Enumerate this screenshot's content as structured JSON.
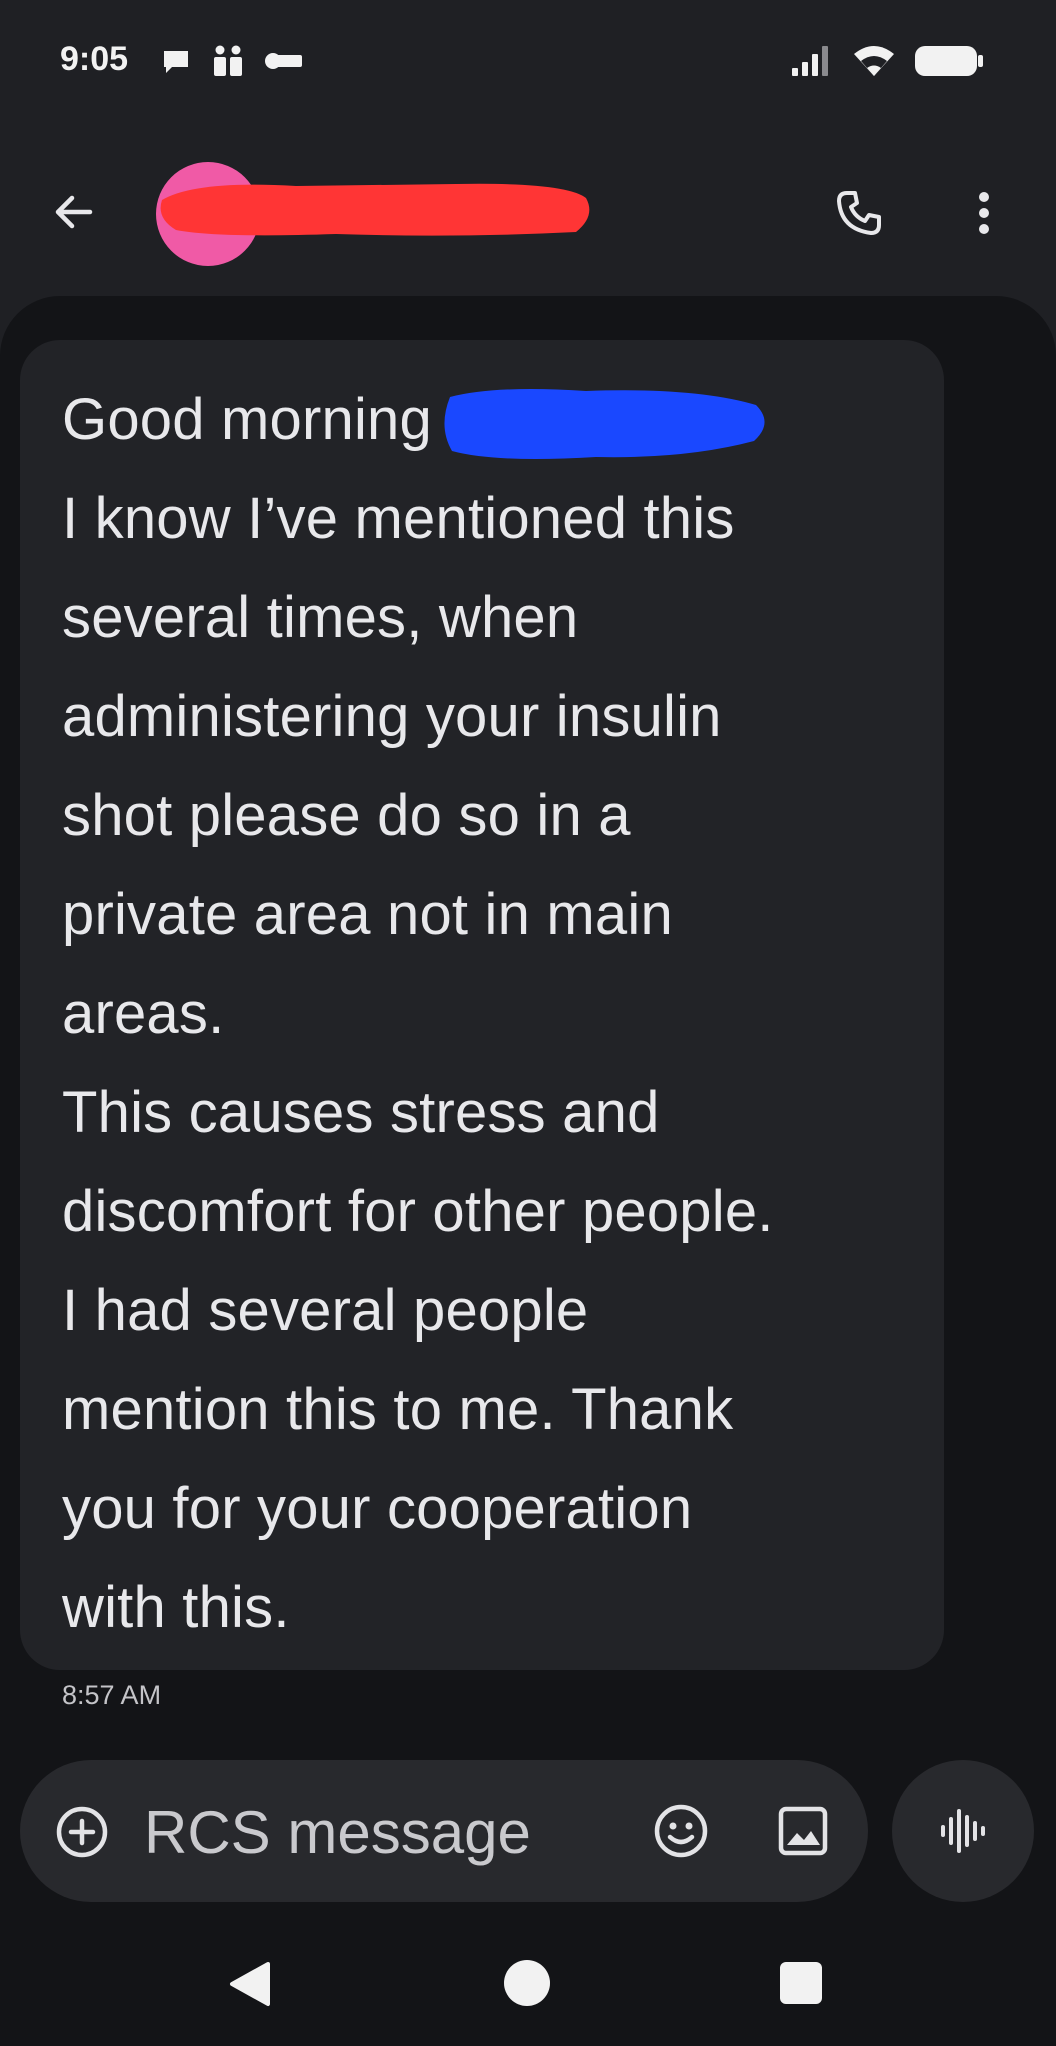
{
  "status_bar": {
    "time": "9:05",
    "icons_left": [
      "chat-bubble-icon",
      "teams-icon",
      "key-icon"
    ],
    "icons_right": [
      "cell-signal-icon",
      "wifi-icon",
      "battery-icon"
    ]
  },
  "header": {
    "contact_name": "",
    "name_redacted": true,
    "avatar_color": "#f05aa6",
    "actions": [
      "phone-icon",
      "more-vert-icon"
    ]
  },
  "message": {
    "lines": [
      "Good morning",
      "I know I’ve mentioned this",
      "several times, when",
      "administering your insulin",
      "shot please do so in a",
      "private area not in main",
      "areas.",
      "This causes stress and",
      "discomfort for other people.",
      "I had several people",
      "mention this to me. Thank",
      "you for your cooperation",
      "with this."
    ],
    "timestamp": "8:57 AM",
    "redaction_colors": {
      "name": "#ff3535",
      "greeting_name": "#1a48ff"
    }
  },
  "composer": {
    "placeholder": "RCS message",
    "icons": [
      "add-circle-icon",
      "emoji-icon",
      "gallery-icon",
      "voice-waveform-icon"
    ]
  },
  "navigation": {
    "buttons": [
      "back-triangle-icon",
      "home-circle-icon",
      "recents-square-icon"
    ]
  }
}
